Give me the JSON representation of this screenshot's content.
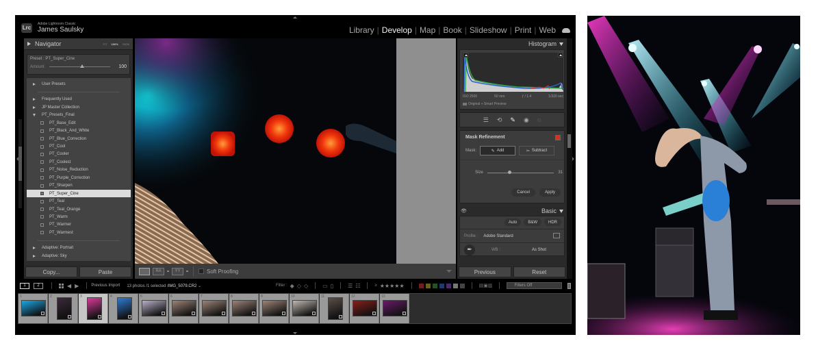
{
  "app": {
    "logo": "Lrc",
    "product": "Adobe Lightroom Classic",
    "user": "James Saulsky"
  },
  "modules": [
    {
      "label": "Library",
      "active": false
    },
    {
      "label": "Develop",
      "active": true
    },
    {
      "label": "Map",
      "active": false
    },
    {
      "label": "Book",
      "active": false
    },
    {
      "label": "Slideshow",
      "active": false
    },
    {
      "label": "Print",
      "active": false
    },
    {
      "label": "Web",
      "active": false
    }
  ],
  "navigator": {
    "title": "Navigator",
    "zoom_options": [
      "FIT",
      "100%",
      "200%"
    ],
    "active_zoom": "100%"
  },
  "preset_amount": {
    "label": "Preset : PT_Super_Cine",
    "amount_label": "Amount",
    "amount_value": "100",
    "amount_fraction": 0.5
  },
  "presets": {
    "groups_top": [
      {
        "label": "User Presets",
        "expanded": false
      }
    ],
    "groups_mid": [
      {
        "label": "Frequently Used",
        "expanded": false
      },
      {
        "label": "JP Master Collection",
        "expanded": false
      },
      {
        "label": "PT_Presets_Final",
        "expanded": true
      }
    ],
    "items": [
      {
        "label": "PT_Base_Edit",
        "selected": false
      },
      {
        "label": "PT_Black_And_White",
        "selected": false
      },
      {
        "label": "PT_Blue_Correction",
        "selected": false
      },
      {
        "label": "PT_Cool",
        "selected": false
      },
      {
        "label": "PT_Cooler",
        "selected": false
      },
      {
        "label": "PT_Coolest",
        "selected": false
      },
      {
        "label": "PT_Noise_Reduction",
        "selected": false
      },
      {
        "label": "PT_Purple_Correction",
        "selected": false
      },
      {
        "label": "PT_Sharpen",
        "selected": false
      },
      {
        "label": "PT_Super_Cine",
        "selected": true
      },
      {
        "label": "PT_Teal",
        "selected": false
      },
      {
        "label": "PT_Teal_Orange",
        "selected": false
      },
      {
        "label": "PT_Warm",
        "selected": false
      },
      {
        "label": "PT_Warmer",
        "selected": false
      },
      {
        "label": "PT_Warmest",
        "selected": false
      }
    ],
    "groups_bottom": [
      {
        "label": "Adaptive: Portrait",
        "expanded": false
      },
      {
        "label": "Adaptive: Sky",
        "expanded": false
      }
    ]
  },
  "left_buttons": {
    "copy": "Copy...",
    "paste": "Paste"
  },
  "toolbar": {
    "soft_proofing_label": "Soft Proofing",
    "soft_proofing_checked": false
  },
  "histogram": {
    "title": "Histogram",
    "iso": "ISO 2500",
    "focal_length": "50 mm",
    "aperture": "ƒ / 1.4",
    "shutter": "1/320 sec",
    "preview_status": "Original + Smart Preview"
  },
  "tools": [
    {
      "name": "edit-sliders-icon",
      "glyph": "☰",
      "active": false
    },
    {
      "name": "crop-icon",
      "glyph": "⟲",
      "active": false
    },
    {
      "name": "healing-eraser-icon",
      "glyph": "✎",
      "active": true
    },
    {
      "name": "red-eye-icon",
      "glyph": "◉",
      "active": false
    },
    {
      "name": "masking-icon",
      "glyph": "◌",
      "active": false
    }
  ],
  "mask_refinement": {
    "title": "Mask Refinement",
    "overlay_color": "#d6301c",
    "mask_label": "Mask:",
    "add_label": "Add",
    "subtract_label": "Subtract",
    "active_mode": "Add",
    "size_label": "Size",
    "size_value": "31",
    "size_fraction": 0.31,
    "cancel_label": "Cancel",
    "apply_label": "Apply"
  },
  "basic": {
    "title": "Basic",
    "auto_label": "Auto",
    "bw_label": "B&W",
    "hdr_label": "HDR",
    "profile_label": "Profile :",
    "profile_value": "Adobe Standard",
    "wb_label": "WB :",
    "wb_value": "As Shot"
  },
  "right_buttons": {
    "previous": "Previous",
    "reset": "Reset"
  },
  "filmstrip_bar": {
    "view1": "1",
    "view2": "2",
    "source": "Previous Import",
    "count_text": "13 photos /1 selected /",
    "filename": "IMG_5079.CR2",
    "filter_label": "Filter :",
    "rating_op": "≥",
    "stars": "★★★★★",
    "color_labels": [
      "#6e1f1f",
      "#6a621c",
      "#245227",
      "#203a6a",
      "#4b2a6a",
      "#777777",
      "#444444"
    ],
    "filter_preset": "Filters Off"
  },
  "filmstrip": {
    "selected_index": 3,
    "thumbs": [
      {
        "num": "1",
        "tone": "#1aa8e8"
      },
      {
        "num": "2",
        "tone": "#3a2a3a"
      },
      {
        "num": "3",
        "tone": "#d73b9a"
      },
      {
        "num": "4",
        "tone": "#2f7bd0"
      },
      {
        "num": "5",
        "tone": "#b8b0c8"
      },
      {
        "num": "6",
        "tone": "#9c8478"
      },
      {
        "num": "7",
        "tone": "#9c8478"
      },
      {
        "num": "8",
        "tone": "#9c8478"
      },
      {
        "num": "9",
        "tone": "#9c8478"
      },
      {
        "num": "10",
        "tone": "#c0b8b0"
      },
      {
        "num": "11",
        "tone": "#5a4e48"
      },
      {
        "num": "12",
        "tone": "#8a1e1a"
      },
      {
        "num": "13",
        "tone": "#6a1a6a"
      }
    ]
  }
}
